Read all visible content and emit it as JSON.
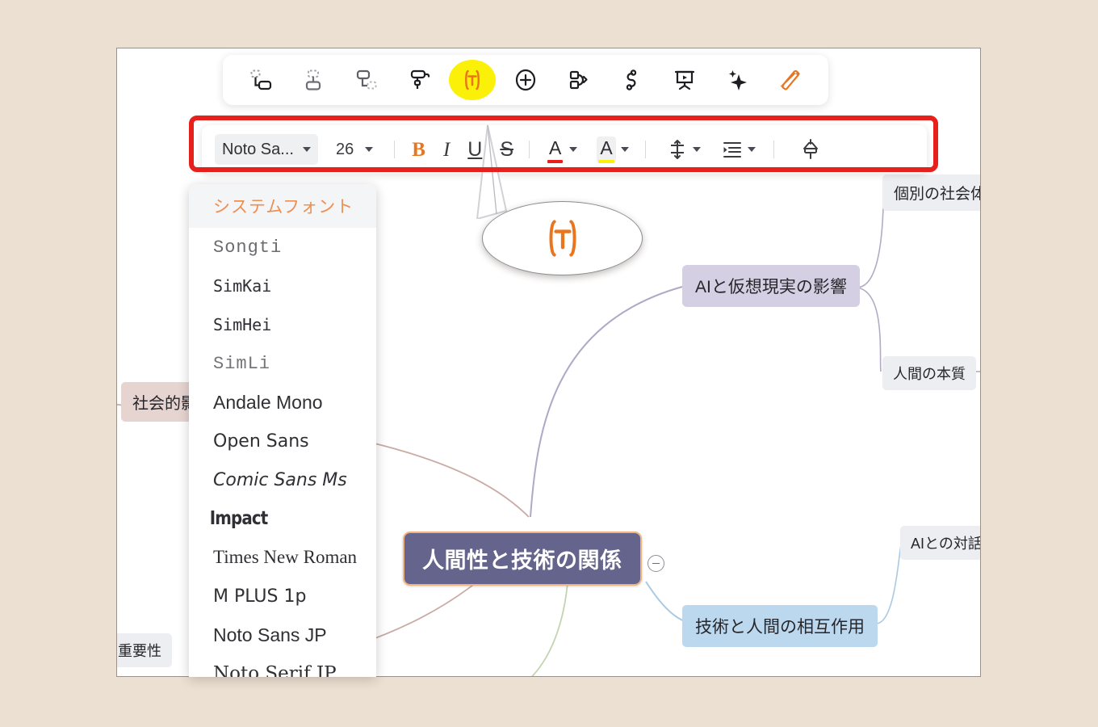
{
  "app": {
    "canvas_background": "#ffffff",
    "page_background": "#ece0d2",
    "annotation_color": "#e8201b",
    "highlight_color": "#fbf008",
    "accent_orange": "#e9761f"
  },
  "icon_toolbar": {
    "items": [
      {
        "name": "insert-sibling-node-icon",
        "label": "Insert sibling topic"
      },
      {
        "name": "insert-child-node-icon",
        "label": "Insert child topic"
      },
      {
        "name": "insert-subtopic-node-icon",
        "label": "Insert subtopic"
      },
      {
        "name": "style-brush-icon",
        "label": "Style brush"
      },
      {
        "name": "text-format-icon",
        "label": "Text format",
        "highlighted": true
      },
      {
        "name": "add-circle-icon",
        "label": "Add"
      },
      {
        "name": "node-relationship-icon",
        "label": "Relationship"
      },
      {
        "name": "connector-line-icon",
        "label": "Connector"
      },
      {
        "name": "presentation-icon",
        "label": "Presentation"
      },
      {
        "name": "ai-sparkle-icon",
        "label": "AI"
      },
      {
        "name": "magic-wand-icon",
        "label": "Magic wand"
      }
    ]
  },
  "format_toolbar": {
    "font_name": "Noto Sa...",
    "font_size": "26",
    "bold_label": "B",
    "italic_label": "I",
    "underline_label": "U",
    "strikethrough_label": "S",
    "font_color_label": "A",
    "font_color_swatch": "#e8201b",
    "highlight_color_label": "A",
    "highlight_color_swatch": "#fbf008",
    "line_height_name": "line-height-icon",
    "indent_name": "indent-icon",
    "format_painter_name": "format-painter-icon"
  },
  "font_menu": {
    "header": "システムフォント",
    "items": [
      {
        "label": "Songti",
        "class": "ff-songti"
      },
      {
        "label": "SimKai",
        "class": "ff-simkai"
      },
      {
        "label": "SimHei",
        "class": "ff-simhei"
      },
      {
        "label": "SimLi",
        "class": "ff-simli"
      },
      {
        "label": "Andale Mono",
        "class": "ff-andale"
      },
      {
        "label": "Open Sans",
        "class": "ff-open"
      },
      {
        "label": "Comic Sans Ms",
        "class": "ff-comic"
      },
      {
        "label": "Impact",
        "class": "ff-impact"
      },
      {
        "label": "Times New Roman",
        "class": "ff-times"
      },
      {
        "label": "M PLUS 1p",
        "class": "ff-mplus"
      },
      {
        "label": "Noto Sans JP",
        "class": "ff-notosans"
      },
      {
        "label": "Noto Serif JP",
        "class": "ff-notoserif"
      }
    ]
  },
  "mindmap": {
    "root": {
      "label": "人間性と技術の関係",
      "color": "#64648c"
    },
    "nodes": [
      {
        "label": "個別の社会体験",
        "color": "#eceef1"
      },
      {
        "label": "AIと仮想現実の影響",
        "color": "#d5cfe3"
      },
      {
        "label": "人間の本質",
        "color": "#eceef1"
      },
      {
        "label": "AIとの対話の",
        "color": "#eceef1"
      },
      {
        "label": "技術と人間の相互作用",
        "color": "#bcd8ef"
      },
      {
        "label": "社会的影",
        "color": "#e6d4d1"
      },
      {
        "label": "重要性",
        "color": "#eceef1"
      }
    ]
  },
  "callout": {
    "icon": "text-format-icon"
  }
}
